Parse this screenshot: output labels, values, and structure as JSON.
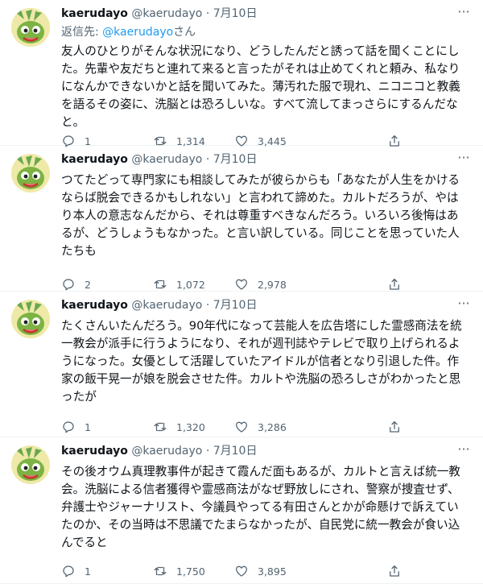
{
  "colors": {
    "link": "#1d9bf0",
    "secondary": "#536471",
    "text": "#0f1419"
  },
  "tweets": [
    {
      "name": "kaerudayo",
      "handle": "@kaerudayo",
      "sep": "·",
      "date": "7月10日",
      "reply_prefix": "返信先: ",
      "reply_mention": "@kaerudayo",
      "reply_suffix": "さん",
      "text": "友人のひとりがそんな状況になり、どうしたんだと誘って話を聞くことにした。先輩や友だちと連れて来ると言ったがそれは止めてくれと頼み、私なりになんかできないかと話を聞いてみた。薄汚れた服で現れ、ニコニコと教義を語るその姿に、洗脳とは恐ろしいな。すべて流してまっさらにするんだなと。",
      "replies": "1",
      "retweets": "1,314",
      "likes": "3,445"
    },
    {
      "name": "kaerudayo",
      "handle": "@kaerudayo",
      "sep": "·",
      "date": "7月10日",
      "text": "つてたどって専門家にも相談してみたが彼らからも「あなたが人生をかけるならば脱会できるかもしれない」と言われて諦めた。カルトだろうが、やはり本人の意志なんだから、それは尊重すべきなんだろう。いろいろ後悔はあるが、どうしょうもなかった。と言い訳している。同じことを思っていた人たちも",
      "replies": "2",
      "retweets": "1,072",
      "likes": "2,978"
    },
    {
      "name": "kaerudayo",
      "handle": "@kaerudayo",
      "sep": "·",
      "date": "7月10日",
      "text": "たくさんいたんだろう。90年代になって芸能人を広告塔にした霊感商法を統一教会が派手に行うようになり、それが週刊誌やテレビで取り上げられるようになった。女優として活躍していたアイドルが信者となり引退した件。作家の飯干晃一が娘を脱会させた件。カルトや洗脳の恐ろしさがわかったと思ったが",
      "replies": "1",
      "retweets": "1,320",
      "likes": "3,286"
    },
    {
      "name": "kaerudayo",
      "handle": "@kaerudayo",
      "sep": "·",
      "date": "7月10日",
      "text": "その後オウム真理教事件が起きて霞んだ面もあるが、カルトと言えば統一教会。洗脳による信者獲得や霊感商法がなぜ野放しにされ、警察が捜査せず、弁護士やジャーナリスト、今議員やってる有田さんとかが命懸けで訴えていたのか、その当時は不思議でたまらなかったが、自民党に統一教会が食い込んでると",
      "replies": "1",
      "retweets": "1,750",
      "likes": "3,895"
    }
  ]
}
